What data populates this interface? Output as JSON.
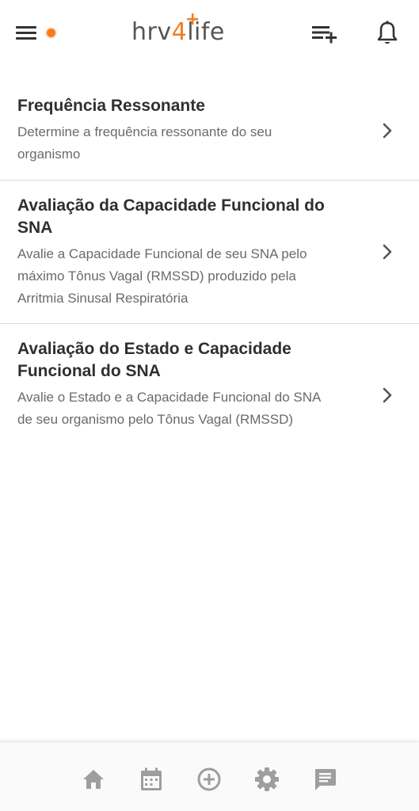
{
  "header": {
    "logo": {
      "part1": "hrv",
      "part2": "4",
      "part3": "life",
      "plus": "+"
    },
    "icons": [
      "menu-icon",
      "status-dot",
      "playlist-add-icon",
      "bell-icon"
    ]
  },
  "items": [
    {
      "title": "Frequência Ressonante",
      "description": "Determine a frequência ressonante do seu organismo"
    },
    {
      "title": "Avaliação da Capacidade Funcional do SNA",
      "description": "Avalie a Capacidade Funcional de seu SNA pelo máximo Tônus Vagal (RMSSD) produzido pela Arritmia Sinusal Respiratória"
    },
    {
      "title": "Avaliação do Estado e Capacidade Funcional do SNA",
      "description": "Avalie o Estado e a Capacidade Funcional do SNA de seu organismo pelo Tônus Vagal (RMSSD)"
    }
  ],
  "bottom_nav": {
    "icons": [
      "home-icon",
      "calendar-icon",
      "add-circle-icon",
      "gear-icon",
      "message-icon"
    ]
  },
  "colors": {
    "accent": "#f57c1f",
    "text": "#2f2f2f",
    "muted": "#6a6a6a",
    "icon": "#333333",
    "nav_icon": "#9e9e9e"
  }
}
